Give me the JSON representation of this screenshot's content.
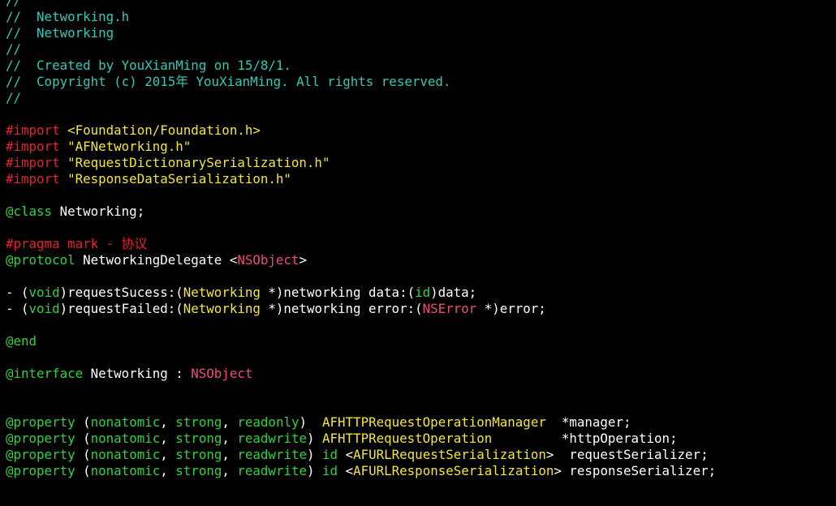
{
  "editor": {
    "lines": [
      [
        {
          "t": "//",
          "c": "comment"
        }
      ],
      [
        {
          "t": "//  Networking.h",
          "c": "comment"
        }
      ],
      [
        {
          "t": "//  Networking",
          "c": "comment"
        }
      ],
      [
        {
          "t": "//",
          "c": "comment"
        }
      ],
      [
        {
          "t": "//  Created by YouXianMing on 15/8/1.",
          "c": "comment"
        }
      ],
      [
        {
          "t": "//  Copyright (c) 2015年 YouXianMing. All rights reserved.",
          "c": "comment"
        }
      ],
      [
        {
          "t": "//",
          "c": "comment"
        }
      ],
      [],
      [
        {
          "t": "#import ",
          "c": "pre"
        },
        {
          "t": "<Foundation/Foundation.h>",
          "c": "str"
        }
      ],
      [
        {
          "t": "#import ",
          "c": "pre"
        },
        {
          "t": "\"AFNetworking.h\"",
          "c": "str"
        }
      ],
      [
        {
          "t": "#import ",
          "c": "pre"
        },
        {
          "t": "\"RequestDictionarySerialization.h\"",
          "c": "str"
        }
      ],
      [
        {
          "t": "#import ",
          "c": "pre"
        },
        {
          "t": "\"ResponseDataSerialization.h\"",
          "c": "str"
        }
      ],
      [],
      [
        {
          "t": "@class",
          "c": "kw"
        },
        {
          "t": " Networking;",
          "c": "text"
        }
      ],
      [],
      [
        {
          "t": "#pragma mark - 协议",
          "c": "mark"
        }
      ],
      [
        {
          "t": "@protocol",
          "c": "kw"
        },
        {
          "t": " NetworkingDelegate <",
          "c": "text"
        },
        {
          "t": "NSObject",
          "c": "class"
        },
        {
          "t": ">",
          "c": "text"
        }
      ],
      [],
      [
        {
          "t": "- (",
          "c": "text"
        },
        {
          "t": "void",
          "c": "kw"
        },
        {
          "t": ")requestSucess:(",
          "c": "text"
        },
        {
          "t": "Networking",
          "c": "type"
        },
        {
          "t": " *)networking data:(",
          "c": "text"
        },
        {
          "t": "id",
          "c": "kw"
        },
        {
          "t": ")data;",
          "c": "text"
        }
      ],
      [
        {
          "t": "- (",
          "c": "text"
        },
        {
          "t": "void",
          "c": "kw"
        },
        {
          "t": ")requestFailed:(",
          "c": "text"
        },
        {
          "t": "Networking",
          "c": "type"
        },
        {
          "t": " *)networking error:(",
          "c": "text"
        },
        {
          "t": "NSError",
          "c": "class"
        },
        {
          "t": " *)error;",
          "c": "text"
        }
      ],
      [],
      [
        {
          "t": "@end",
          "c": "kw"
        }
      ],
      [],
      [
        {
          "t": "@interface",
          "c": "kw"
        },
        {
          "t": " Networking : ",
          "c": "text"
        },
        {
          "t": "NSObject",
          "c": "class"
        }
      ],
      [],
      [],
      [
        {
          "t": "@property",
          "c": "kw"
        },
        {
          "t": " (",
          "c": "text"
        },
        {
          "t": "nonatomic",
          "c": "kw"
        },
        {
          "t": ", ",
          "c": "text"
        },
        {
          "t": "strong",
          "c": "kw"
        },
        {
          "t": ", ",
          "c": "text"
        },
        {
          "t": "readonly",
          "c": "kw"
        },
        {
          "t": ")  ",
          "c": "text"
        },
        {
          "t": "AFHTTPRequestOperationManager",
          "c": "type"
        },
        {
          "t": "  *manager;",
          "c": "text"
        }
      ],
      [
        {
          "t": "@property",
          "c": "kw"
        },
        {
          "t": " (",
          "c": "text"
        },
        {
          "t": "nonatomic",
          "c": "kw"
        },
        {
          "t": ", ",
          "c": "text"
        },
        {
          "t": "strong",
          "c": "kw"
        },
        {
          "t": ", ",
          "c": "text"
        },
        {
          "t": "readwrite",
          "c": "kw"
        },
        {
          "t": ") ",
          "c": "text"
        },
        {
          "t": "AFHTTPRequestOperation",
          "c": "type"
        },
        {
          "t": "         *httpOperation;",
          "c": "text"
        }
      ],
      [
        {
          "t": "@property",
          "c": "kw"
        },
        {
          "t": " (",
          "c": "text"
        },
        {
          "t": "nonatomic",
          "c": "kw"
        },
        {
          "t": ", ",
          "c": "text"
        },
        {
          "t": "strong",
          "c": "kw"
        },
        {
          "t": ", ",
          "c": "text"
        },
        {
          "t": "readwrite",
          "c": "kw"
        },
        {
          "t": ") ",
          "c": "text"
        },
        {
          "t": "id",
          "c": "kw"
        },
        {
          "t": " <",
          "c": "text"
        },
        {
          "t": "AFURLRequestSerialization",
          "c": "type"
        },
        {
          "t": ">  requestSerializer;",
          "c": "text"
        }
      ],
      [
        {
          "t": "@property",
          "c": "kw"
        },
        {
          "t": " (",
          "c": "text"
        },
        {
          "t": "nonatomic",
          "c": "kw"
        },
        {
          "t": ", ",
          "c": "text"
        },
        {
          "t": "strong",
          "c": "kw"
        },
        {
          "t": ", ",
          "c": "text"
        },
        {
          "t": "readwrite",
          "c": "kw"
        },
        {
          "t": ") ",
          "c": "text"
        },
        {
          "t": "id",
          "c": "kw"
        },
        {
          "t": " <",
          "c": "text"
        },
        {
          "t": "AFURLResponseSerialization",
          "c": "type"
        },
        {
          "t": "> responseSerializer;",
          "c": "text"
        }
      ]
    ]
  },
  "colors": {
    "background": "#000000",
    "comment": "#34c9b8",
    "preprocessor": "#e8222c",
    "string": "#f3e63a",
    "keyword": "#31d240",
    "text": "#ffffff",
    "class": "#ee4d7a"
  }
}
